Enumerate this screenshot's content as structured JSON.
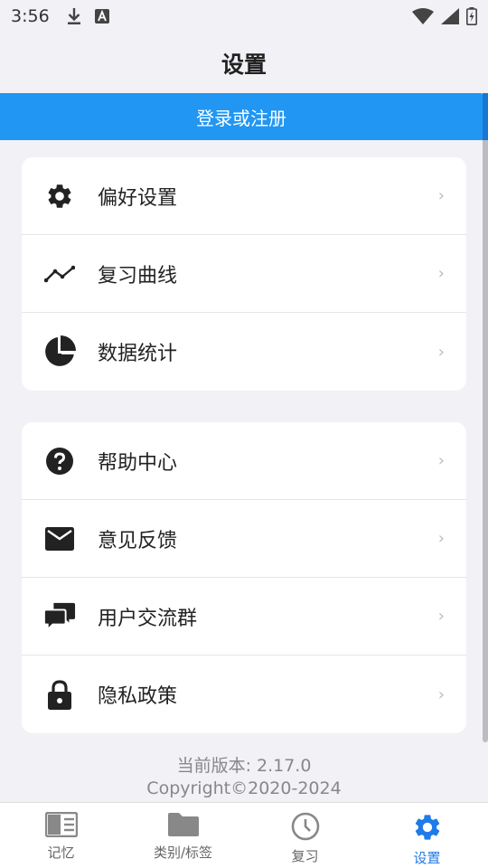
{
  "status_bar": {
    "time": "3:56"
  },
  "header": {
    "title": "设置"
  },
  "login": {
    "label": "登录或注册"
  },
  "sections": [
    {
      "items": [
        {
          "label": "偏好设置",
          "icon": "gear-icon"
        },
        {
          "label": "复习曲线",
          "icon": "line-chart-icon"
        },
        {
          "label": "数据统计",
          "icon": "pie-chart-icon"
        }
      ]
    },
    {
      "items": [
        {
          "label": "帮助中心",
          "icon": "help-icon"
        },
        {
          "label": "意见反馈",
          "icon": "mail-icon"
        },
        {
          "label": "用户交流群",
          "icon": "chat-icon"
        },
        {
          "label": "隐私政策",
          "icon": "lock-icon"
        }
      ]
    }
  ],
  "footer": {
    "version": "当前版本: 2.17.0",
    "copyright": "Copyright©2020-2024"
  },
  "tabs": [
    {
      "label": "记忆",
      "icon": "memory-book-icon"
    },
    {
      "label": "类别/标签",
      "icon": "folder-icon"
    },
    {
      "label": "复习",
      "icon": "clock-icon"
    },
    {
      "label": "设置",
      "icon": "settings-gear-icon"
    }
  ],
  "colors": {
    "accent": "#2196f3",
    "active_tab": "#1e7be8",
    "background": "#f1f1f6"
  }
}
